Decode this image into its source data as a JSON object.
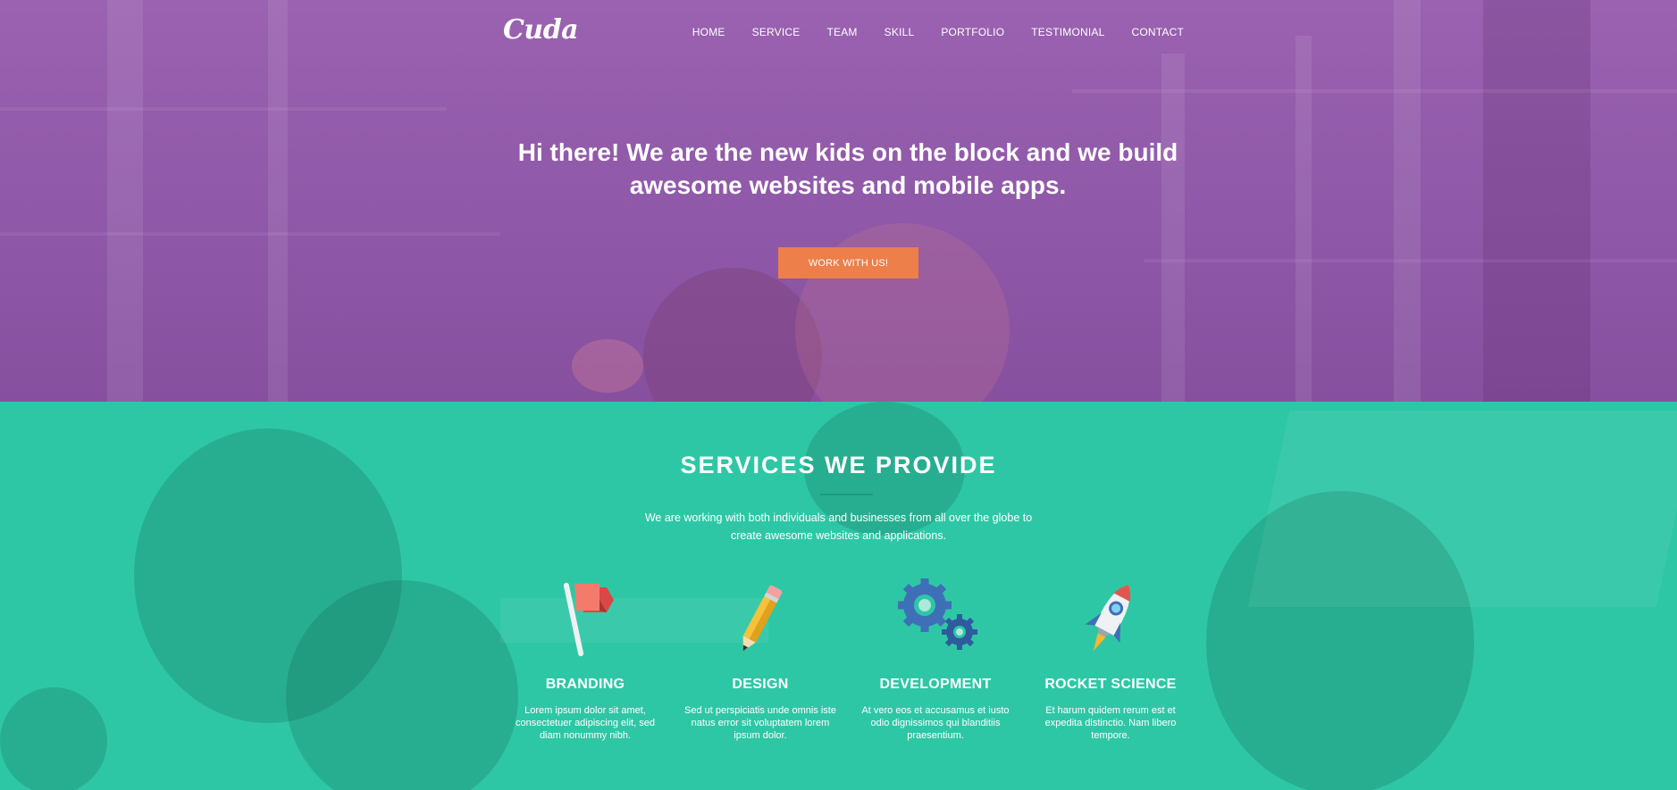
{
  "brand": {
    "logo_text": "Cuda"
  },
  "nav": {
    "items": [
      "HOME",
      "SERVICE",
      "TEAM",
      "SKILL",
      "PORTFOLIO",
      "TESTIMONIAL",
      "CONTACT"
    ]
  },
  "hero": {
    "title": "Hi there! We are the new kids on the block and we build awesome websites and mobile apps.",
    "cta_label": "WORK WITH US!"
  },
  "services": {
    "title": "SERVICES WE PROVIDE",
    "subtitle": "We are working with both individuals and businesses from all over the globe to create awesome websites and applications.",
    "items": [
      {
        "icon": "flag-icon",
        "name": "BRANDING",
        "desc": "Lorem ipsum dolor sit amet, consectetuer adipiscing elit, sed diam nonummy nibh."
      },
      {
        "icon": "pencil-icon",
        "name": "DESIGN",
        "desc": "Sed ut perspiciatis unde omnis iste natus error sit voluptatem lorem ipsum dolor."
      },
      {
        "icon": "gears-icon",
        "name": "DEVELOPMENT",
        "desc": "At vero eos et accusamus et iusto odio dignissimos qui blanditiis praesentium."
      },
      {
        "icon": "rocket-icon",
        "name": "ROCKET SCIENCE",
        "desc": "Et harum quidem rerum est et expedita distinctio. Nam libero tempore."
      }
    ]
  },
  "colors": {
    "hero_overlay": "#9a62b0",
    "services_bg": "#2ec7a6",
    "cta_bg": "#ec7f4a"
  }
}
